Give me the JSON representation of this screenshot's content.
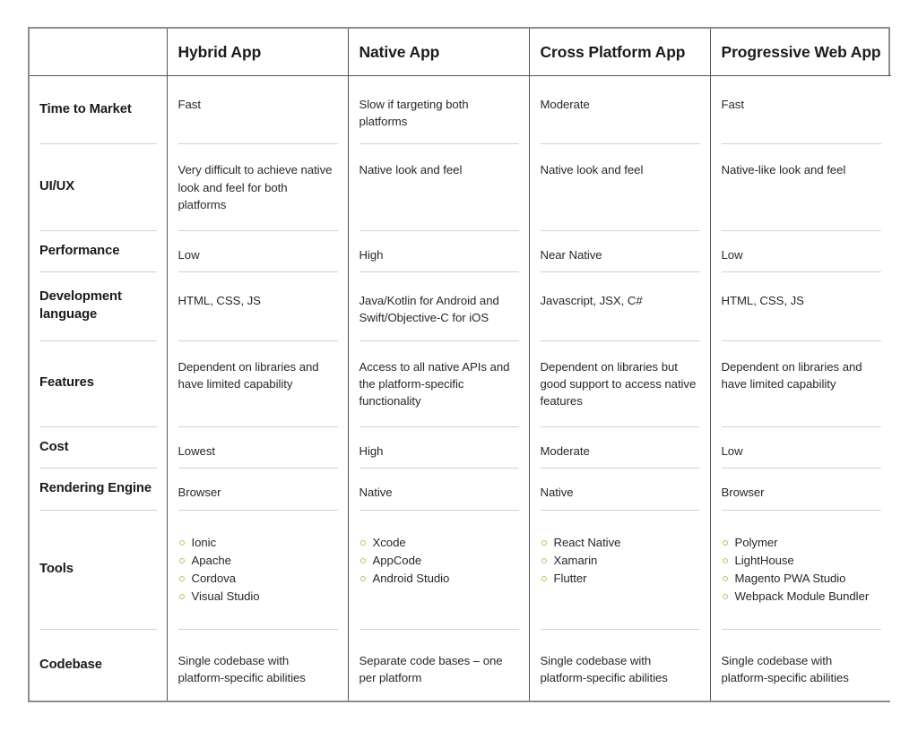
{
  "table": {
    "colors": {
      "outer_border": "#8d8d8d",
      "divider": "#555555",
      "row_separator": "#d2d2d2",
      "bullet": "#aec85c",
      "label_text": "#1b1b1b",
      "cell_text": "#282828"
    },
    "corner_label": "",
    "headers": [
      "Hybrid App",
      "Native App",
      "Cross Platform App",
      "Progressive Web App"
    ],
    "rows": [
      {
        "label": "Time to Market",
        "cells": [
          {
            "text": "Fast"
          },
          {
            "text": "Slow if targeting both platforms"
          },
          {
            "text": "Moderate"
          },
          {
            "text": "Fast"
          }
        ]
      },
      {
        "label": "UI/UX",
        "cells": [
          {
            "text": "Very difficult to achieve native look and feel for both platforms"
          },
          {
            "text": "Native look and feel"
          },
          {
            "text": "Native look and feel"
          },
          {
            "text": "Native-like look and feel"
          }
        ]
      },
      {
        "label": "Performance",
        "cells": [
          {
            "text": "Low"
          },
          {
            "text": "High"
          },
          {
            "text": "Near Native"
          },
          {
            "text": "Low"
          }
        ]
      },
      {
        "label": "Development language",
        "cells": [
          {
            "text": "HTML, CSS, JS"
          },
          {
            "text": "Java/Kotlin for Android and Swift/Objective-C for iOS"
          },
          {
            "text": "Javascript, JSX, C#"
          },
          {
            "text": "HTML, CSS, JS"
          }
        ]
      },
      {
        "label": "Features",
        "cells": [
          {
            "text": "Dependent on libraries and have limited capability"
          },
          {
            "text": "Access to all native APIs and the platform-specific functionality"
          },
          {
            "text": "Dependent on libraries but good support to access native features"
          },
          {
            "text": "Dependent on libraries and have limited capability"
          }
        ]
      },
      {
        "label": "Cost",
        "cells": [
          {
            "text": "Lowest"
          },
          {
            "text": "High"
          },
          {
            "text": "Moderate"
          },
          {
            "text": "Low"
          }
        ]
      },
      {
        "label": "Rendering Engine",
        "cells": [
          {
            "text": "Browser"
          },
          {
            "text": "Native"
          },
          {
            "text": "Native"
          },
          {
            "text": "Browser"
          }
        ]
      },
      {
        "label": "Tools",
        "cells": [
          {
            "list": [
              "Ionic",
              "Apache",
              "Cordova",
              "Visual Studio"
            ]
          },
          {
            "list": [
              "Xcode",
              "AppCode",
              "Android Studio"
            ]
          },
          {
            "list": [
              "React Native",
              "Xamarin",
              "Flutter"
            ]
          },
          {
            "list": [
              "Polymer",
              "LightHouse",
              "Magento PWA Studio",
              "Webpack Module Bundler"
            ]
          }
        ]
      },
      {
        "label": "Codebase",
        "cells": [
          {
            "text": "Single codebase with platform-specific abilities"
          },
          {
            "text": "Separate code bases – one per platform"
          },
          {
            "text": "Single codebase with platform-specific abilities"
          },
          {
            "text": "Single codebase with platform-specific abilities"
          }
        ]
      }
    ]
  }
}
